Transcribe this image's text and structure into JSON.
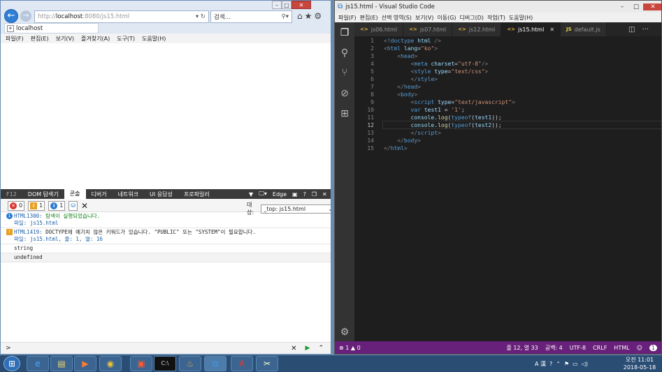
{
  "ie": {
    "address_host_prefix": "http://",
    "address_host": "localhost",
    "address_rest": ":8080/js15.html",
    "search_placeholder": "검색...",
    "tab_title": "localhost",
    "menu": [
      "파일(F)",
      "편집(E)",
      "보기(V)",
      "즐겨찾기(A)",
      "도구(T)",
      "도움말(H)"
    ],
    "devtools": {
      "tabs": [
        "F12",
        "DOM 탐색기",
        "콘솔",
        "디버거",
        "네트워크",
        "UI 응답성",
        "프로파일러"
      ],
      "selected_tab": "콘솔",
      "mode": "Edge",
      "error_count": "0",
      "warning_count": "1",
      "info_count": "1",
      "target_label": "대상:",
      "target_value": "_top: js15.html",
      "console_lines": [
        {
          "type": "info",
          "code": "HTML1300:",
          "msg": "탐색이 실행되었습니다.",
          "file": "파일: js15.html"
        },
        {
          "type": "warn",
          "code": "HTML1419:",
          "msg": "DOCTYPE에 예기치 않은 키워드가 있습니다. \"PUBLIC\" 또는 \"SYSTEM\"이 필요합니다.",
          "file": "파일: js15.html, 줄: 1, 열: 16"
        },
        {
          "type": "log",
          "msg": "string"
        },
        {
          "type": "log",
          "msg": "undefined"
        }
      ],
      "prompt": ">"
    }
  },
  "vscode": {
    "title": "js15.html - Visual Studio Code",
    "menu": [
      "파일(F)",
      "편집(E)",
      "선택 영역(S)",
      "보기(V)",
      "이동(G)",
      "디버그(D)",
      "작업(T)",
      "도움말(H)"
    ],
    "tabs": [
      "js06.html",
      "js07.html",
      "js12.html",
      "js15.html",
      "default.js"
    ],
    "active_tab": "js15.html",
    "line_numbers": [
      "1",
      "2",
      "3",
      "4",
      "5",
      "6",
      "7",
      "8",
      "9",
      "10",
      "11",
      "12",
      "13",
      "14",
      "15"
    ],
    "status": {
      "problems": "1",
      "warnings": "0",
      "position": "줄 12, 열 33",
      "spaces": "공백: 4",
      "encoding": "UTF-8",
      "eol": "CRLF",
      "language": "HTML",
      "bell": "1"
    }
  },
  "taskbar": {
    "lang": "A 漢",
    "clock_time": "오전 11:01",
    "clock_date": "2018-05-18"
  }
}
